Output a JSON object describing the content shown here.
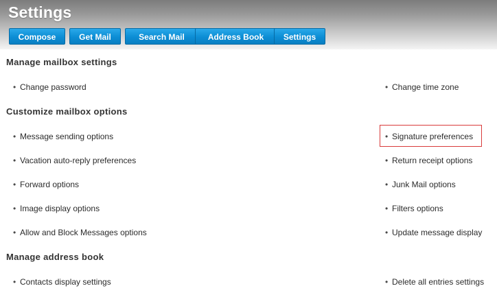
{
  "header": {
    "title": "Settings"
  },
  "toolbar": {
    "compose": "Compose",
    "get_mail": "Get Mail",
    "search_mail": "Search Mail",
    "address_book": "Address Book",
    "settings": "Settings"
  },
  "bullet": "•",
  "sections": {
    "manage_mailbox": {
      "title": "Manage mailbox settings",
      "left": [
        "Change password"
      ],
      "right": [
        "Change time zone"
      ]
    },
    "customize_mailbox": {
      "title": "Customize mailbox options",
      "left": [
        "Message sending options",
        "Vacation auto-reply preferences",
        "Forward options",
        "Image display options",
        "Allow and Block Messages options"
      ],
      "right": [
        "Signature preferences",
        "Return receipt options",
        "Junk Mail options",
        "Filters options",
        "Update message display"
      ]
    },
    "manage_address_book": {
      "title": "Manage address book",
      "left": [
        "Contacts display settings"
      ],
      "right": [
        "Delete all entries settings"
      ]
    }
  },
  "colors": {
    "button_blue": "#0c8dd4",
    "highlight_red": "#d83a3a",
    "header_gray": "#9a9a9a"
  }
}
